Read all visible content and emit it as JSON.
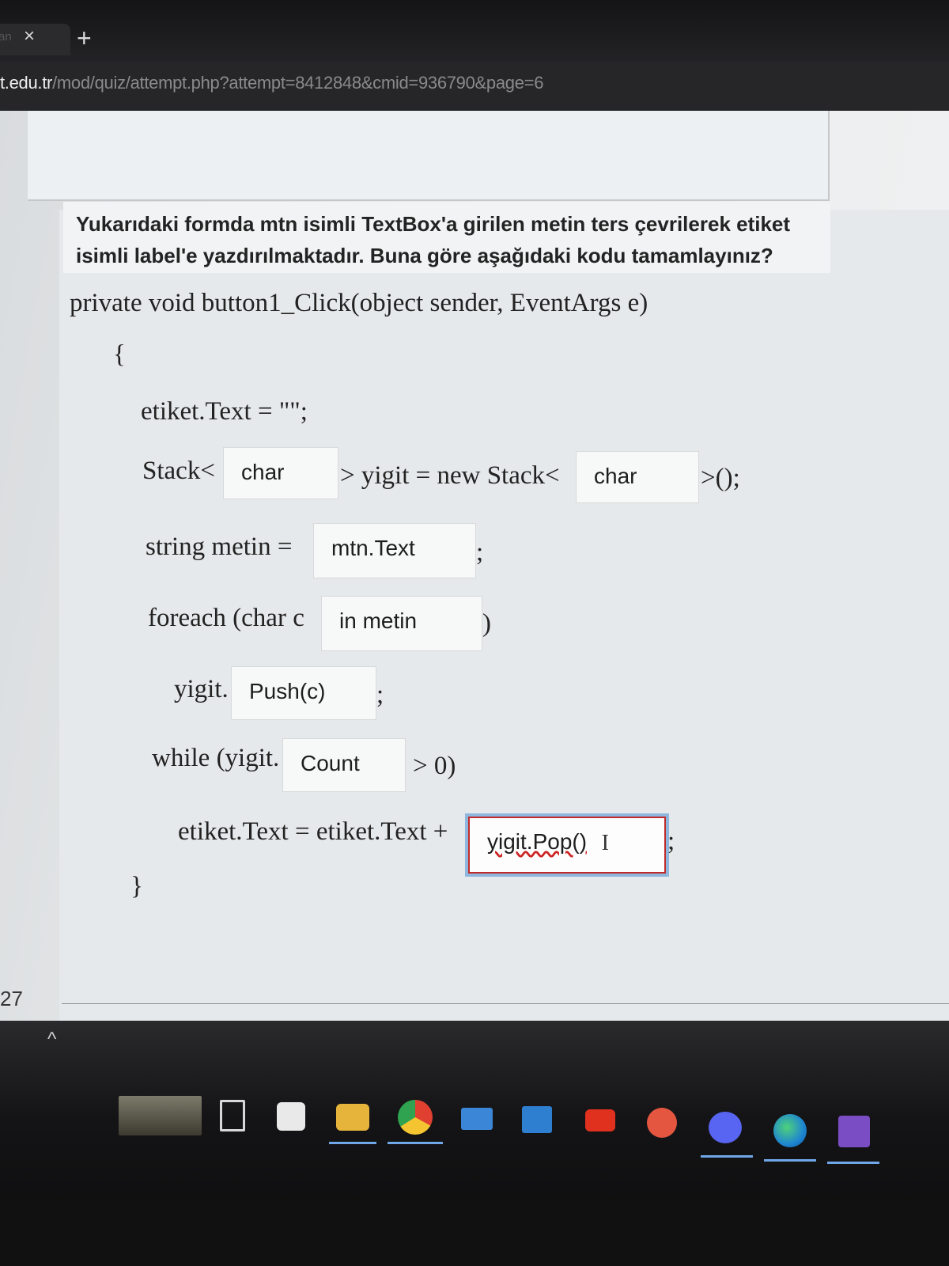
{
  "browser": {
    "tab_title": "an",
    "tab_close": "×",
    "new_tab": "+",
    "url_host": "t.edu.tr",
    "url_path": "/mod/quiz/attempt.php?attempt=8412848&cmid=936790&page=6"
  },
  "question": {
    "text": "Yukarıdaki formda mtn isimli TextBox'a girilen metin ters çevrilerek etiket isimli label'e yazdırılmaktadır. Buna göre aşağıdaki kodu tamamlayınız?",
    "code": {
      "signature": "private void button1_Click(object sender, EventArgs e)",
      "open_brace": "{",
      "line_clear": "etiket.Text = \"\";",
      "stack_prefix": "Stack<",
      "stack_middle": "> yigit = new Stack<",
      "stack_suffix": ">();",
      "string_prefix": "string metin =",
      "string_suffix": ";",
      "foreach_prefix": "foreach (char c",
      "foreach_suffix": ")",
      "push_prefix": "yigit.",
      "push_suffix": ";",
      "while_prefix": "while (yigit.",
      "while_suffix": "> 0)",
      "append_prefix": "etiket.Text = etiket.Text +",
      "append_suffix": ";",
      "close_brace": "}"
    },
    "answers": {
      "stack_type_1": "char",
      "stack_type_2": "char",
      "metin_value": "mtn.Text",
      "foreach_in": "in metin",
      "push_call": "Push(c)",
      "count_prop": "Count",
      "pop_call": "yigit.Pop()"
    }
  },
  "footer": {
    "question_number": "27"
  },
  "taskbar": {
    "chevron": "^",
    "icons": [
      "wallpaper-thumbnail-icon",
      "task-view-icon",
      "microsoft-store-icon",
      "file-explorer-icon",
      "chrome-icon",
      "mail-icon",
      "calendar-icon",
      "youtube-icon",
      "media-player-icon",
      "discord-icon",
      "edge-icon",
      "visual-studio-icon"
    ]
  },
  "colors": {
    "active_border": "#c02a2a",
    "focus_ring": "#8fb7dd"
  }
}
